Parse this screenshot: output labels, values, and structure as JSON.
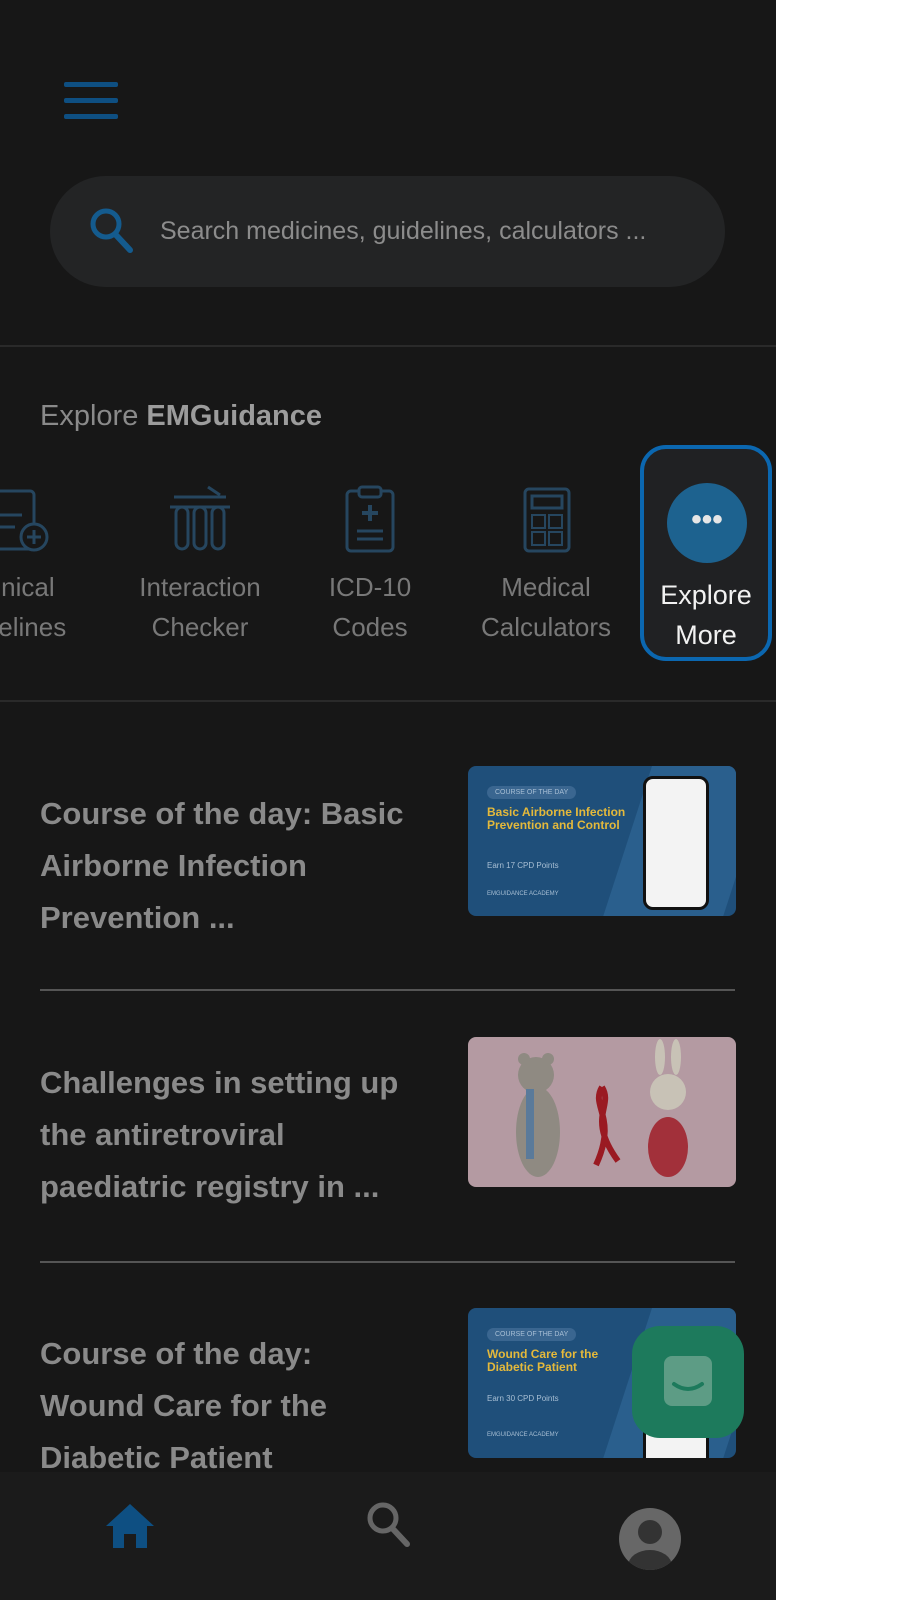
{
  "search": {
    "placeholder": "Search medicines, guidelines, calculators ..."
  },
  "explore": {
    "prefix": "Explore ",
    "brand": "EMGuidance",
    "tools": [
      {
        "line1": "inical",
        "line2": "delines",
        "icon": "clinical-guidelines-icon"
      },
      {
        "line1": "Interaction",
        "line2": "Checker",
        "icon": "test-tubes-icon"
      },
      {
        "line1": "ICD-10",
        "line2": "Codes",
        "icon": "clipboard-plus-icon"
      },
      {
        "line1": "Medical",
        "line2": "Calculators",
        "icon": "calculator-icon"
      }
    ],
    "more": {
      "line1": "Explore",
      "line2": "More",
      "icon": "more-dots-icon"
    }
  },
  "articles": [
    {
      "title": "Course of the day: Basic Airborne Infection Prevention ...",
      "thumb": {
        "tag": "COURSE OF THE DAY",
        "title": "Basic Airborne Infection Prevention and Control",
        "points": "Earn 17 CPD Points",
        "brand": "EMGUIDANCE ACADEMY"
      }
    },
    {
      "title": "Challenges in setting up the antiretroviral paediatric registry in ..."
    },
    {
      "title": "Course of the day: Wound Care for the Diabetic Patient",
      "thumb": {
        "tag": "COURSE OF THE DAY",
        "title": "Wound Care for the Diabetic Patient",
        "points": "Earn 30 CPD Points",
        "brand": "EMGUIDANCE ACADEMY"
      }
    }
  ],
  "bottom_nav": {
    "items": [
      "home-icon",
      "search-icon",
      "profile-icon"
    ],
    "active": "home-icon"
  },
  "colors": {
    "accent": "#0b67b0",
    "background": "#171717",
    "chat": "#1d7a5c"
  }
}
